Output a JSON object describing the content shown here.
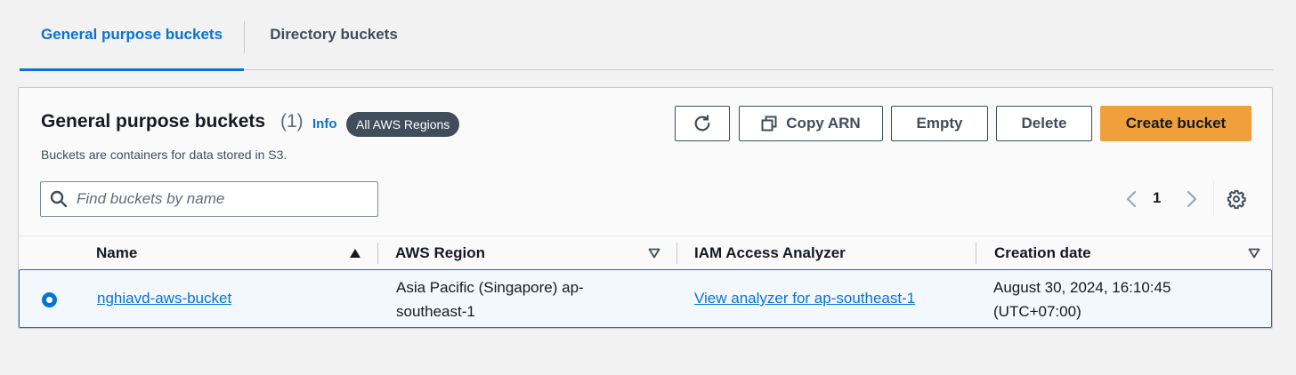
{
  "tabs": [
    {
      "label": "General purpose buckets",
      "active": true
    },
    {
      "label": "Directory buckets",
      "active": false
    }
  ],
  "header": {
    "title": "General purpose buckets",
    "count": "(1)",
    "info_label": "Info",
    "region_badge": "All AWS Regions",
    "description": "Buckets are containers for data stored in S3."
  },
  "actions": {
    "refresh_icon": "refresh-icon",
    "copy_arn_label": "Copy ARN",
    "empty_label": "Empty",
    "delete_label": "Delete",
    "create_label": "Create bucket"
  },
  "search": {
    "placeholder": "Find buckets by name",
    "value": ""
  },
  "pagination": {
    "current_page": "1"
  },
  "table": {
    "columns": [
      {
        "label": "Name",
        "sort": "ascending"
      },
      {
        "label": "AWS Region",
        "sort": "sortable"
      },
      {
        "label": "IAM Access Analyzer",
        "sort": "none"
      },
      {
        "label": "Creation date",
        "sort": "sortable"
      }
    ],
    "rows": [
      {
        "selected": true,
        "name": "nghiavd-aws-bucket",
        "region": "Asia Pacific (Singapore) ap-southeast-1",
        "iam": "View analyzer for ap-southeast-1",
        "created": "August 30, 2024, 16:10:45 (UTC+07:00)"
      }
    ]
  },
  "colors": {
    "accent": "#0972d3",
    "primary_button": "#f0a03a",
    "badge_bg": "#414d5c",
    "text": "#16191f",
    "secondary_text": "#5f6b7a"
  }
}
